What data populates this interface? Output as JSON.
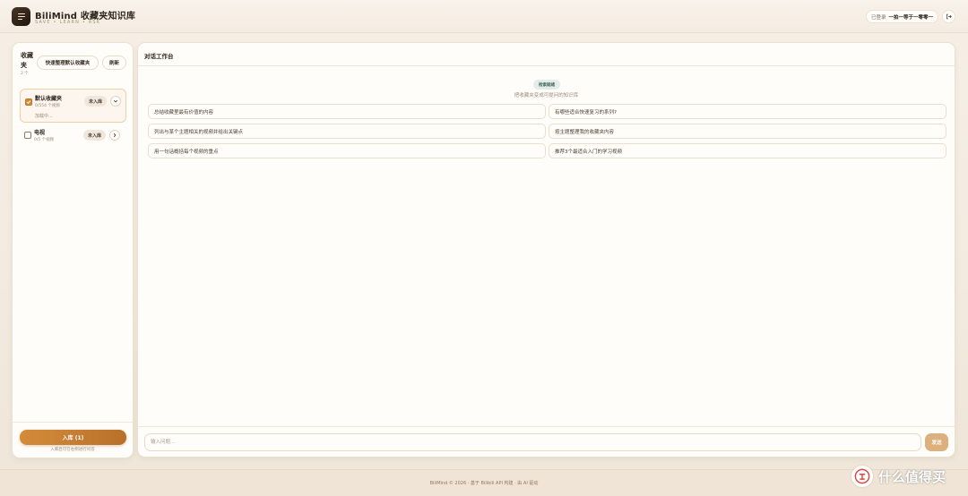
{
  "app": {
    "title": "BiliMind 收藏夹知识库",
    "subtitle": "SAVE • LEARN • ASK"
  },
  "header": {
    "login_label": "已登录",
    "username": "一拍一等于一零零一",
    "logout_icon": "logout-icon"
  },
  "sidebar": {
    "title": "收藏夹",
    "count": "2 个",
    "quick_button": "快速整理默认收藏夹",
    "refresh_button": "刷新",
    "folders": [
      {
        "name": "默认收藏夹",
        "meta": "0/554 个视频",
        "status": "加载中...",
        "action": "未入库",
        "checked": true,
        "toggle_icon": "chevron-down-icon"
      },
      {
        "name": "电视",
        "meta": "0/5 个视频",
        "status": "",
        "action": "未入库",
        "checked": false,
        "toggle_icon": "chevron-right-icon"
      }
    ],
    "import_button": "入库 (1)",
    "import_hint": "入库后可在右侧进行问答"
  },
  "main": {
    "title": "对话工作台",
    "badge": "检索就绪",
    "hint": "把收藏夹变成可提问的知识库",
    "suggestions": [
      "总结收藏里最有价值的内容",
      "有哪些适合快速复习的系列?",
      "列出与某个主题相关的视频并给出关键点",
      "按主题整理我的收藏夹内容",
      "用一句话概括每个视频的重点",
      "推荐3个最适合入门的学习视频"
    ],
    "input_placeholder": "输入问题...",
    "send_button": "发送"
  },
  "footer": {
    "text": "BiliMind © 2026 · 基于 Bilibili API 构建 · 由 AI 驱动"
  },
  "watermark": {
    "text": "什么值得买"
  },
  "colors": {
    "accent": "#d08b3a",
    "accent_dark": "#b8702a",
    "background": "#f4ece2",
    "panel": "#fffdfa",
    "badge_bg": "#e3ece9"
  }
}
